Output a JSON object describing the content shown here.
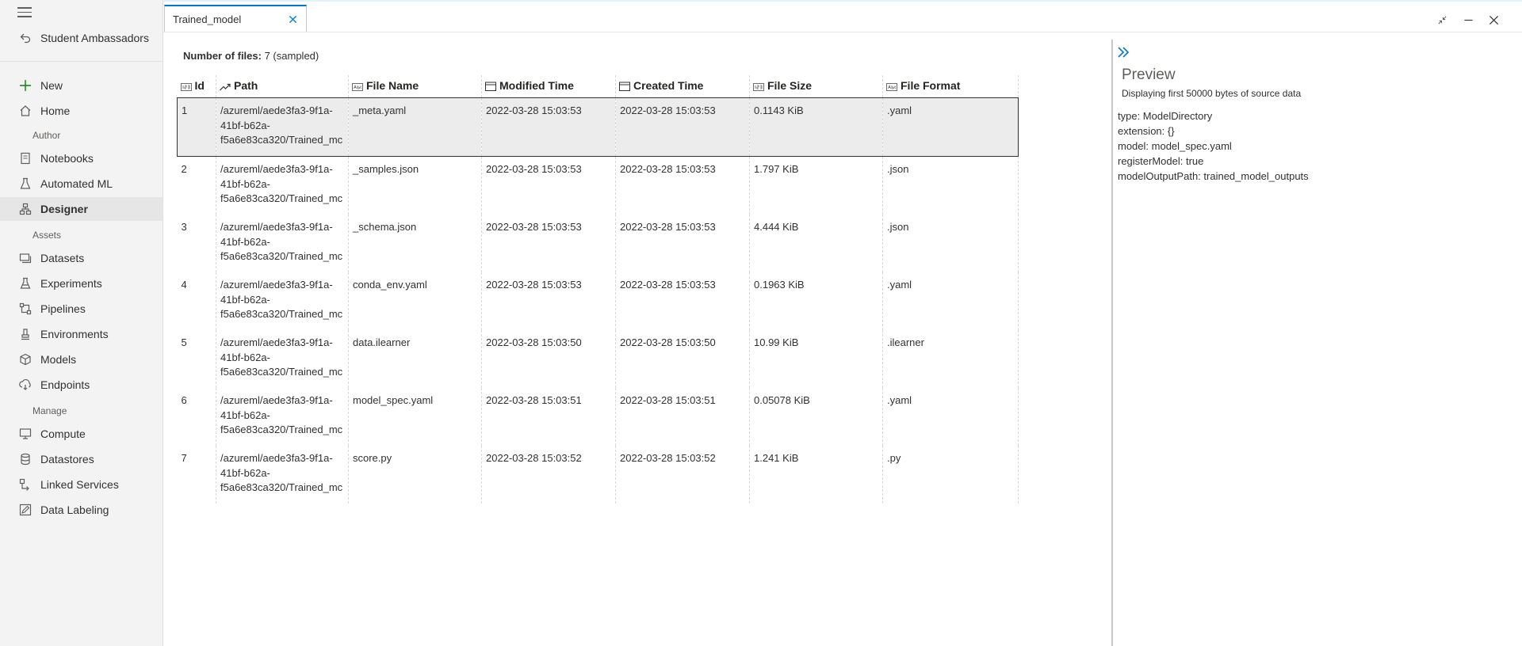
{
  "sidebar": {
    "back_label": "Student Ambassadors",
    "new_label": "New",
    "home_label": "Home",
    "sections": {
      "author": "Author",
      "assets": "Assets",
      "manage": "Manage"
    },
    "author_items": [
      {
        "label": "Notebooks",
        "icon": "notebook-icon"
      },
      {
        "label": "Automated ML",
        "icon": "flask-icon"
      },
      {
        "label": "Designer",
        "icon": "designer-icon",
        "active": true
      }
    ],
    "asset_items": [
      {
        "label": "Datasets",
        "icon": "datasets-icon"
      },
      {
        "label": "Experiments",
        "icon": "experiments-icon"
      },
      {
        "label": "Pipelines",
        "icon": "pipelines-icon"
      },
      {
        "label": "Environments",
        "icon": "environments-icon"
      },
      {
        "label": "Models",
        "icon": "models-icon"
      },
      {
        "label": "Endpoints",
        "icon": "endpoints-icon"
      }
    ],
    "manage_items": [
      {
        "label": "Compute",
        "icon": "compute-icon"
      },
      {
        "label": "Datastores",
        "icon": "datastores-icon"
      },
      {
        "label": "Linked Services",
        "icon": "linked-services-icon"
      },
      {
        "label": "Data Labeling",
        "icon": "data-labeling-icon"
      }
    ]
  },
  "tab": {
    "label": "Trained_model"
  },
  "main": {
    "file_count_label": "Number of files:",
    "file_count_value": "7 (sampled)",
    "columns": [
      "Id",
      "Path",
      "File Name",
      "Modified Time",
      "Created Time",
      "File Size",
      "File Format"
    ],
    "rows": [
      {
        "id": "1",
        "path": [
          "/azureml/aede3fa3-9f1a-",
          "41bf-b62a-",
          "f5a6e83ca320/Trained_mc"
        ],
        "file_name": "_meta.yaml",
        "modified": "2022-03-28 15:03:53",
        "created": "2022-03-28 15:03:53",
        "size": "0.1143 KiB",
        "format": ".yaml",
        "selected": true
      },
      {
        "id": "2",
        "path": [
          "/azureml/aede3fa3-9f1a-",
          "41bf-b62a-",
          "f5a6e83ca320/Trained_mc"
        ],
        "file_name": "_samples.json",
        "modified": "2022-03-28 15:03:53",
        "created": "2022-03-28 15:03:53",
        "size": "1.797 KiB",
        "format": ".json"
      },
      {
        "id": "3",
        "path": [
          "/azureml/aede3fa3-9f1a-",
          "41bf-b62a-",
          "f5a6e83ca320/Trained_mc"
        ],
        "file_name": "_schema.json",
        "modified": "2022-03-28 15:03:53",
        "created": "2022-03-28 15:03:53",
        "size": "4.444 KiB",
        "format": ".json"
      },
      {
        "id": "4",
        "path": [
          "/azureml/aede3fa3-9f1a-",
          "41bf-b62a-",
          "f5a6e83ca320/Trained_mc"
        ],
        "file_name": "conda_env.yaml",
        "modified": "2022-03-28 15:03:53",
        "created": "2022-03-28 15:03:53",
        "size": "0.1963 KiB",
        "format": ".yaml"
      },
      {
        "id": "5",
        "path": [
          "/azureml/aede3fa3-9f1a-",
          "41bf-b62a-",
          "f5a6e83ca320/Trained_mc"
        ],
        "file_name": "data.ilearner",
        "modified": "2022-03-28 15:03:50",
        "created": "2022-03-28 15:03:50",
        "size": "10.99 KiB",
        "format": ".ilearner"
      },
      {
        "id": "6",
        "path": [
          "/azureml/aede3fa3-9f1a-",
          "41bf-b62a-",
          "f5a6e83ca320/Trained_mc"
        ],
        "file_name": "model_spec.yaml",
        "modified": "2022-03-28 15:03:51",
        "created": "2022-03-28 15:03:51",
        "size": "0.05078 KiB",
        "format": ".yaml"
      },
      {
        "id": "7",
        "path": [
          "/azureml/aede3fa3-9f1a-",
          "41bf-b62a-",
          "f5a6e83ca320/Trained_mc"
        ],
        "file_name": "score.py",
        "modified": "2022-03-28 15:03:52",
        "created": "2022-03-28 15:03:52",
        "size": "1.241 KiB",
        "format": ".py"
      }
    ]
  },
  "preview": {
    "title": "Preview",
    "subtitle": "Displaying first 50000 bytes of source data",
    "lines": [
      "type: ModelDirectory",
      "extension: {}",
      "model: model_spec.yaml",
      "registerModel: true",
      "modelOutputPath: trained_model_outputs"
    ]
  },
  "colors": {
    "accent": "#0078d4",
    "new_plus": "#107c10"
  }
}
